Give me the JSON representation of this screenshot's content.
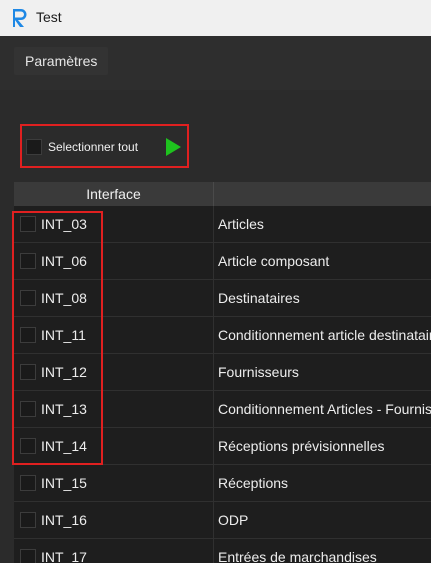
{
  "window": {
    "title": "Test"
  },
  "menu": {
    "items": [
      "Paramètres"
    ]
  },
  "toolbar": {
    "select_all_label": "Selectionner tout"
  },
  "table": {
    "headers": [
      "Interface",
      ""
    ],
    "rows": [
      {
        "code": "INT_03",
        "description": "Articles"
      },
      {
        "code": "INT_06",
        "description": "Article composant"
      },
      {
        "code": "INT_08",
        "description": "Destinataires"
      },
      {
        "code": "INT_11",
        "description": "Conditionnement article destinataire"
      },
      {
        "code": "INT_12",
        "description": "Fournisseurs"
      },
      {
        "code": "INT_13",
        "description": "Conditionnement Articles - Fournisseurs"
      },
      {
        "code": "INT_14",
        "description": "Réceptions prévisionnelles"
      },
      {
        "code": "INT_15",
        "description": "Réceptions"
      },
      {
        "code": "INT_16",
        "description": "ODP"
      },
      {
        "code": "INT_17",
        "description": "Entrées de marchandises"
      }
    ]
  },
  "colors": {
    "highlight": "#e02020",
    "play": "#1ec21e",
    "logo": "#1e88e5",
    "background": "#2b2b2b"
  },
  "icons": {
    "logo": "r-logo-icon",
    "run": "play-icon"
  }
}
